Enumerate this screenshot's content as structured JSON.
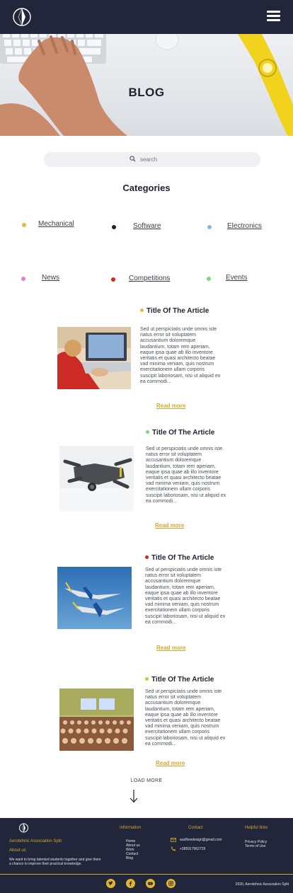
{
  "header": {
    "logo_icon": "compass-logo-icon",
    "menu_icon": "hamburger-menu-icon"
  },
  "hero": {
    "title": "BLOG"
  },
  "search": {
    "placeholder": "search",
    "icon": "search-icon"
  },
  "categories": {
    "title": "Categories",
    "items": [
      {
        "label": "Mechanical",
        "color": "#e5b84c"
      },
      {
        "label": "Software",
        "color": "#1e2130"
      },
      {
        "label": "Electronics",
        "color": "#8fb6e3"
      },
      {
        "label": "News",
        "color": "#e57adf"
      },
      {
        "label": "Competitions",
        "color": "#e0201d"
      },
      {
        "label": "Events",
        "color": "#7fd77a"
      }
    ]
  },
  "articles": [
    {
      "title": "Title Of The Article",
      "dot_color": "#e5b84c",
      "text": "Sed ut perspiciatis unde omnis iste natus error sit voluptatem accusantium doloremque laudantium, totam rem aperiam, eaque ipsa quae ab illo inventore veritatis et quasi architecto beatae vad minima veniam, quis nostrum exercitationem ullam corporis suscipit laboriosam, nisi ut aliquid ex ea commodi...",
      "read_more": "Read more",
      "image": "laptop-photo"
    },
    {
      "title": "Title Of The Article",
      "dot_color": "#7fd77a",
      "text": "Sed ut perspiciatis unde omnis iste natus error sit voluptatem accusantium doloremque laudantium, totam rem aperiam, eaque ipsa quae ab illo inventore veritatis et quasi architecto beatae vad minima veniam, quis nostrum exercitationem ullam corporis suscipit laboriosam, nisi ut aliquid ex ea commodi...",
      "read_more": "Read more",
      "image": "drone-photo"
    },
    {
      "title": "Title Of The Article",
      "dot_color": "#e0201d",
      "text": "Sed ut perspiciatis unde omnis iste natus error sit voluptatem accusantium doloremque laudantium, totam rem aperiam, eaque ipsa quae ab illo inventore veritatis et quasi architecto beatae vad minima veniam, quis nostrum exercitationem ullam corporis suscipit laboriosam, nisi ut aliquid ex ea commodi...",
      "read_more": "Read more",
      "image": "jets-photo"
    },
    {
      "title": "Title Of The Article",
      "dot_color": "#e5b84c",
      "text": "Sed ut perspiciatis unde omnis iste natus error sit voluptatem accusantium doloremque laudantium, totam rem aperiam, eaque ipsa quae ab illo inventore veritatis et quasi architecto beatae vad minima veniam, quis nostrum exercitationem ullam corporis suscipit laboriosam, nisi ut aliquid ex ea commodi...",
      "read_more": "Read more",
      "image": "lecture-hall-photo"
    }
  ],
  "load_more": {
    "label": "LOAD MORE",
    "icon": "arrow-down-icon"
  },
  "footer": {
    "org_name": "Aerotehnic Association Split",
    "about_heading": "About us",
    "about_text": "We want to bring talented students together and give them a chance to improve their practical knowledge.",
    "information_heading": "Information",
    "information_links": [
      "Home",
      "About us",
      "Work",
      "Contact",
      "Blog"
    ],
    "contact_heading": "Contact",
    "contact_email": "ausflowdesign@gmail.com",
    "contact_phone": "+385917962729",
    "helpful_heading": "Helpful links",
    "helpful_links": [
      "Privacy Policy",
      "Terms of Use"
    ],
    "social": [
      "twitter-icon",
      "facebook-icon",
      "youtube-icon",
      "instagram-icon"
    ],
    "copyright": "2020, Aerotehnic Association Split",
    "accent": "#d4a82a"
  }
}
